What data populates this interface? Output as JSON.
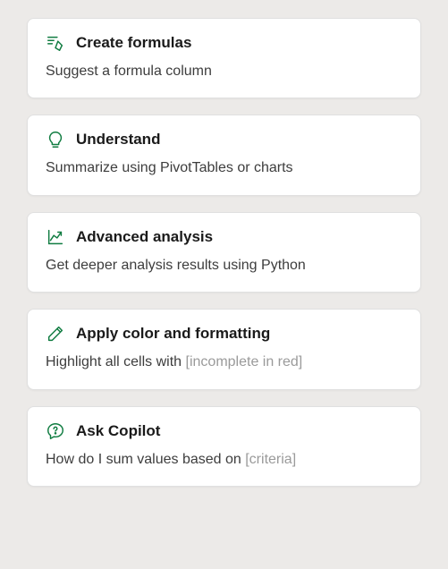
{
  "accent_color": "#107C41",
  "cards": [
    {
      "id": "create-formulas",
      "icon": "formula-pen-icon",
      "title": "Create formulas",
      "description": "Suggest a formula column",
      "placeholder": ""
    },
    {
      "id": "understand",
      "icon": "lightbulb-icon",
      "title": "Understand",
      "description": "Summarize using PivotTables or charts",
      "placeholder": ""
    },
    {
      "id": "advanced-analysis",
      "icon": "chart-up-icon",
      "title": "Advanced analysis",
      "description": "Get deeper analysis results using Python",
      "placeholder": ""
    },
    {
      "id": "apply-formatting",
      "icon": "pencil-icon",
      "title": "Apply color and formatting",
      "description": "Highlight all cells with ",
      "placeholder": "[incomplete in red]"
    },
    {
      "id": "ask-copilot",
      "icon": "chat-question-icon",
      "title": "Ask Copilot",
      "description": "How do I sum values based on ",
      "placeholder": "[criteria]"
    }
  ]
}
